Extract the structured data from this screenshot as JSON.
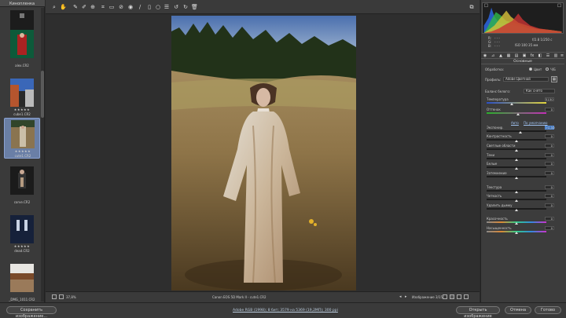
{
  "filmstrip": {
    "title": "Кинопленка",
    "items": [
      {
        "name": "lev.CR2",
        "stars": "",
        "selected": false
      },
      {
        "name": "alex.CR2",
        "stars": "",
        "selected": false
      },
      {
        "name": "cube1.CR2",
        "stars": "★★★★★",
        "selected": false
      },
      {
        "name": "cute1.CR2",
        "stars": "★★★★★",
        "selected": true
      },
      {
        "name": "corve.CR2",
        "stars": "",
        "selected": false
      },
      {
        "name": "dead.CR2",
        "stars": "★★★★★",
        "selected": false
      },
      {
        "name": "_DMG_1011.CR2",
        "stars": "",
        "selected": false
      }
    ]
  },
  "toolbar": {
    "tools": [
      "zoom-icon",
      "hand-icon",
      "white-balance-icon",
      "color-sampler-icon",
      "target-adjust-icon",
      "crop-icon",
      "straighten-icon",
      "spot-removal-icon",
      "red-eye-icon",
      "brush-icon",
      "graduated-filter-icon",
      "radial-filter-icon",
      "preferences-icon",
      "rotate-left-icon",
      "rotate-right-icon",
      "trash-icon"
    ],
    "fullscreen": "fullscreen-icon"
  },
  "status": {
    "zoom": "37,8%",
    "filename": "Canon EOS 5D Mark II  -  cute1.CR2",
    "image_count": "Изображение 3/15"
  },
  "footer": {
    "save_label": "Сохранить изображение...",
    "workflow_link": "Adobe RGB (1998); 8 бит; 3579 на 5369 (19,2МП); 300 ppi",
    "open_label": "Открыть изображение",
    "cancel_label": "Отмена",
    "done_label": "Готово"
  },
  "readout": {
    "r": "R:",
    "g": "G:",
    "b": "B:",
    "exposure": "f/2.8   1/250 с",
    "iso": "ISO 100    35 мм",
    "r_val": "- - -",
    "g_val": "- - -",
    "b_val": "- - -"
  },
  "panel": {
    "section_title": "Основные",
    "treatment_label": "Обработка:",
    "treatment_color": "Цвет",
    "treatment_bw": "Ч/Б",
    "profile_label": "Профиль:",
    "profile_value": "Adobe Цветной",
    "wb_label": "Баланс белого:",
    "wb_value": "Как снято",
    "auto_link": "Авто",
    "default_link": "По умолчанию"
  },
  "sliders": [
    {
      "label": "Температура",
      "value": "5150",
      "pos": 0.42,
      "active": false
    },
    {
      "label": "Оттенок",
      "value": "0",
      "pos": 0.52,
      "active": false
    },
    {
      "label": "Экспонир.",
      "value": "+0,50",
      "pos": 0.56,
      "active": true
    },
    {
      "label": "Контрастность",
      "value": "0",
      "pos": 0.5,
      "active": false
    },
    {
      "label": "Светлые области",
      "value": "0",
      "pos": 0.5,
      "active": false
    },
    {
      "label": "Тени",
      "value": "0",
      "pos": 0.5,
      "active": false
    },
    {
      "label": "Белые",
      "value": "0",
      "pos": 0.5,
      "active": false
    },
    {
      "label": "Затемнение",
      "value": "0",
      "pos": 0.5,
      "active": false
    },
    {
      "label": "Текстура",
      "value": "0",
      "pos": 0.5,
      "active": false
    },
    {
      "label": "Четкость",
      "value": "0",
      "pos": 0.5,
      "active": false
    },
    {
      "label": "Удалить дымку",
      "value": "0",
      "pos": 0.5,
      "active": false
    },
    {
      "label": "Красочность",
      "value": "0",
      "pos": 0.5,
      "active": false
    },
    {
      "label": "Насыщенность",
      "value": "0",
      "pos": 0.5,
      "active": false
    }
  ],
  "colors": {
    "accent": "#3b6fb6",
    "selection": "#6a7fa6",
    "panel": "#3c3c3c"
  }
}
